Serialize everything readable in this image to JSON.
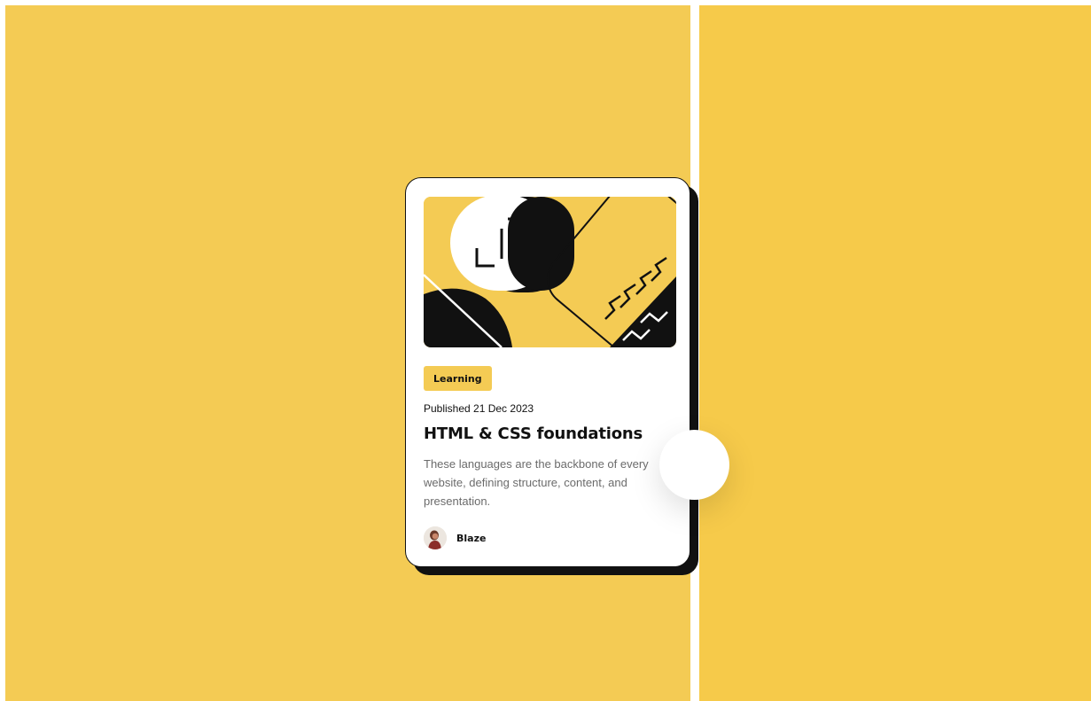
{
  "colors": {
    "background_left": "#F4CB54",
    "background_right": "#F6CA4A",
    "accent_yellow": "#F4CB54",
    "card_border": "#111111",
    "text_dark": "#111111",
    "text_muted": "#6B6B6B"
  },
  "card": {
    "tag": "Learning",
    "published": "Published 21 Dec 2023",
    "title": "HTML & CSS foundations",
    "description": "These languages are the backbone of every website, defining structure, content, and presentation.",
    "author": {
      "name": "Blaze",
      "avatar_icon": "person-avatar"
    },
    "illustration_icon": "abstract-code-illustration"
  },
  "comparison": {
    "handle_icon": "slider-handle"
  }
}
